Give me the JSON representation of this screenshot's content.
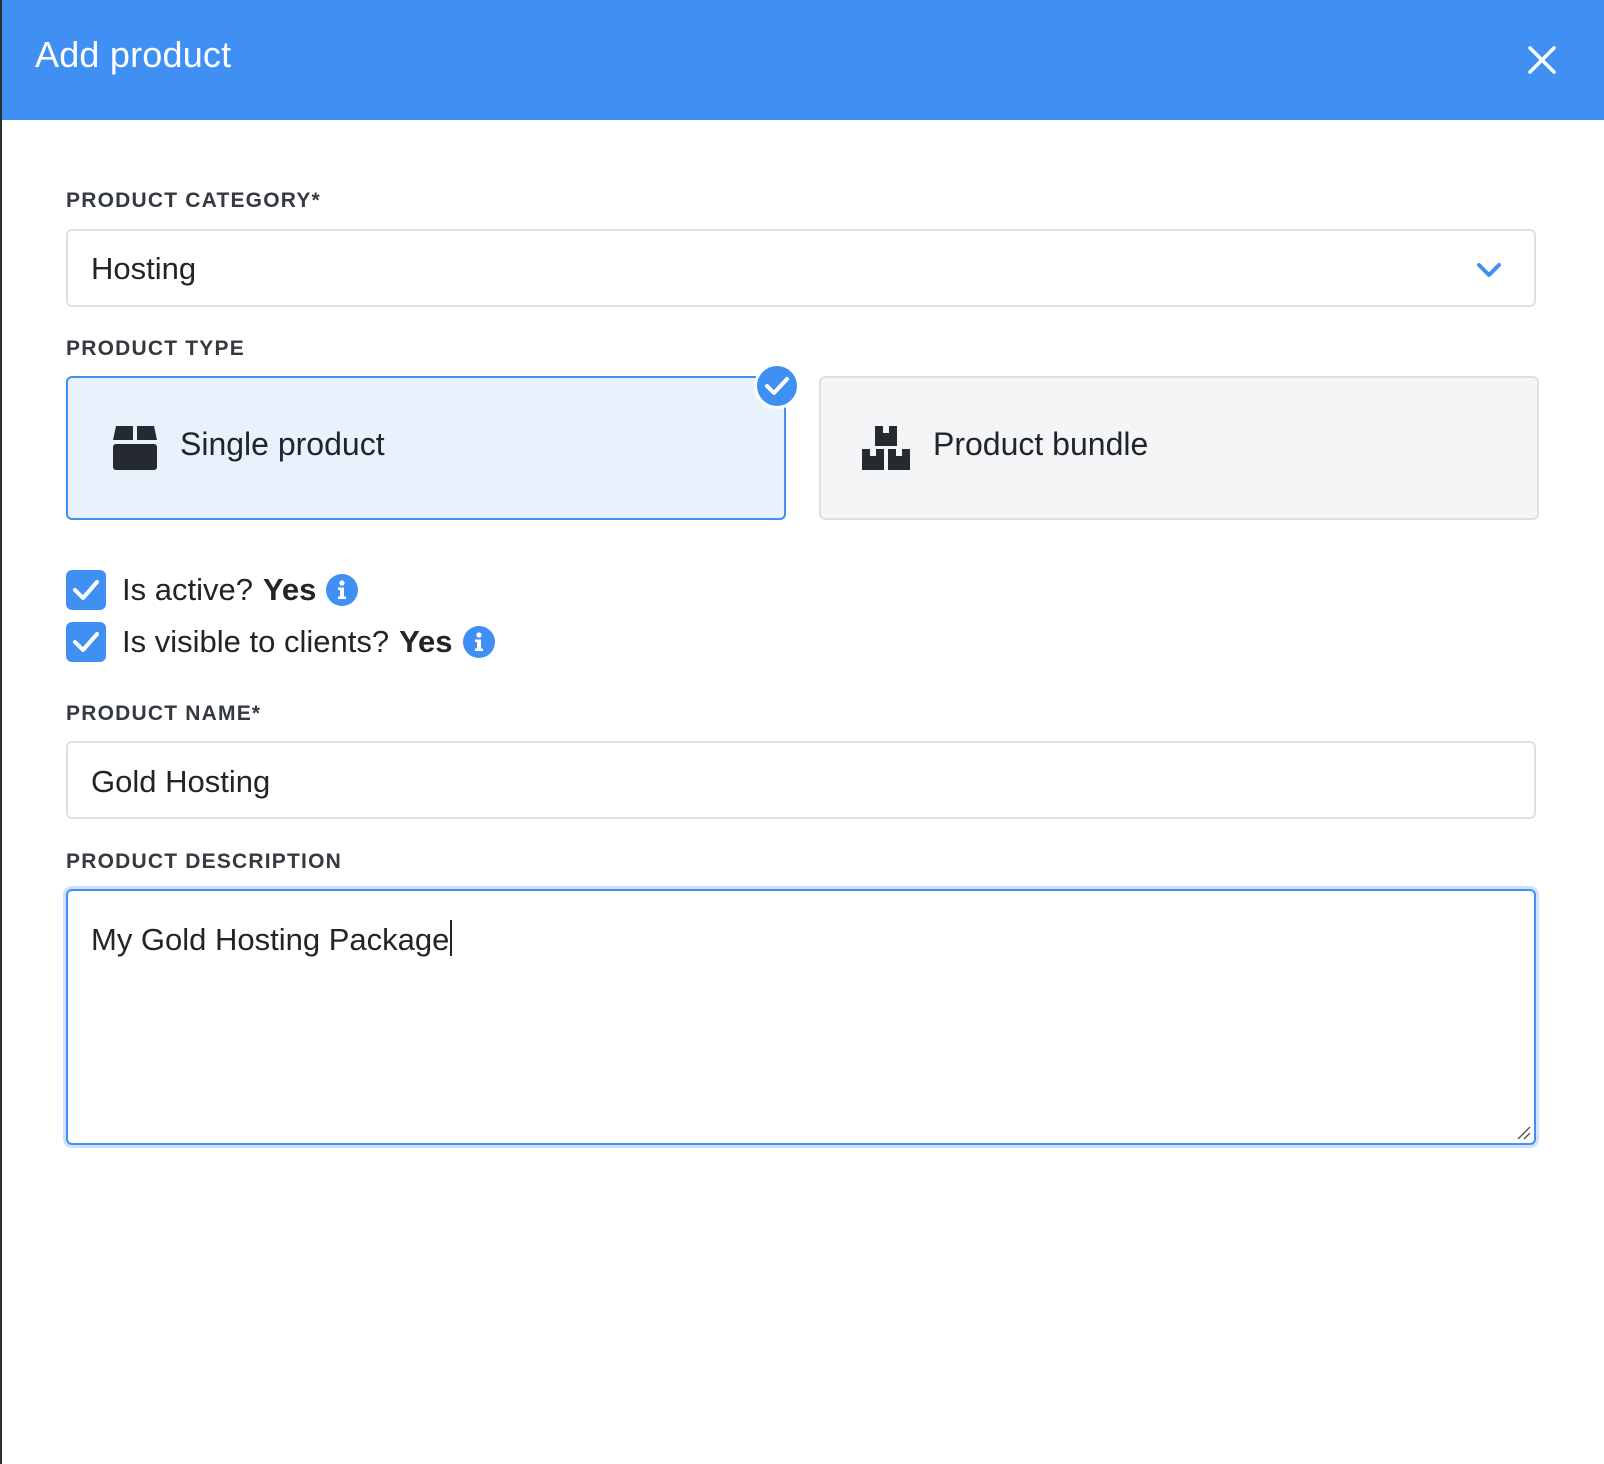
{
  "dialog": {
    "title": "Add product",
    "close_icon": "close-icon",
    "header_color": "#4090f3"
  },
  "category": {
    "label": "PRODUCT CATEGORY*",
    "selected": "Hosting",
    "icon": "chevron-down-icon"
  },
  "product_type": {
    "label": "PRODUCT TYPE",
    "options": [
      {
        "label": "Single product",
        "icon": "box-icon",
        "selected": true
      },
      {
        "label": "Product bundle",
        "icon": "boxes-icon",
        "selected": false
      }
    ]
  },
  "toggles": {
    "active": {
      "label": "Is active?",
      "value": "Yes",
      "checked": true,
      "icon": "info-icon"
    },
    "visible": {
      "label": "Is visible to clients?",
      "value": "Yes",
      "checked": true,
      "icon": "info-icon"
    }
  },
  "name": {
    "label": "PRODUCT NAME*",
    "value": "Gold Hosting"
  },
  "description": {
    "label": "PRODUCT DESCRIPTION",
    "value": "My Gold Hosting Package"
  },
  "colors": {
    "accent": "#4090f3",
    "selected_bg": "#e8f2fd",
    "unselected_bg": "#f3f5f7"
  }
}
